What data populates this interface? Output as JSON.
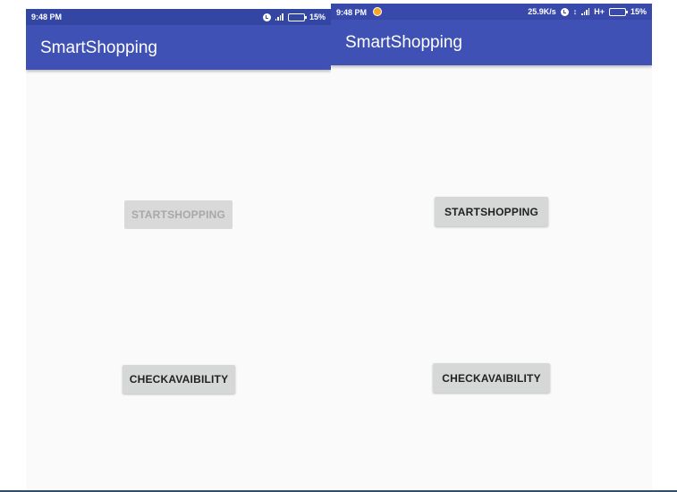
{
  "left_screen": {
    "status_bar": {
      "time": "9:48 PM",
      "battery": "15%",
      "icons": [
        "alarm-icon",
        "signal-icon",
        "battery-icon"
      ]
    },
    "app_bar": {
      "title": "SmartShopping"
    },
    "buttons": {
      "start_shopping": {
        "label": "STARTSHOPPING",
        "enabled": false
      },
      "check_availability": {
        "label": "CHECKAVAIBILITY",
        "enabled": true
      }
    }
  },
  "right_screen": {
    "status_bar": {
      "time": "9:48 PM",
      "network_speed": "25.9K/s",
      "network_type": "H+",
      "battery": "15%",
      "icons": [
        "notification-icon",
        "alarm-icon",
        "data-arrows-icon",
        "signal-icon",
        "battery-icon"
      ]
    },
    "app_bar": {
      "title": "SmartShopping"
    },
    "buttons": {
      "start_shopping": {
        "label": "STARTSHOPPING",
        "enabled": true
      },
      "check_availability": {
        "label": "CHECKAVAIBILITY",
        "enabled": true
      }
    }
  },
  "colors": {
    "status_bar": "#3949ab",
    "app_bar": "#3f51b5",
    "background": "#fafafa",
    "button": "#d6d7d7"
  }
}
